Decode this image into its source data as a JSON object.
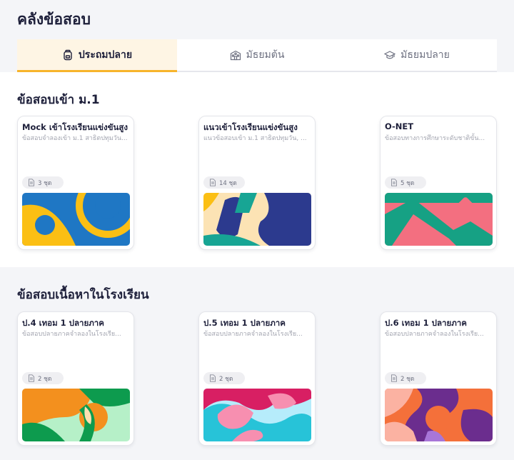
{
  "page_title": "คลังข้อสอบ",
  "tabs": [
    {
      "label": "ประถมปลาย",
      "icon": "backpack-icon",
      "active": true
    },
    {
      "label": "มัธยมต้น",
      "icon": "school-icon",
      "active": false
    },
    {
      "label": "มัธยมปลาย",
      "icon": "graduation-cap-icon",
      "active": false
    }
  ],
  "sections": [
    {
      "title": "ข้อสอบเข้า ม.1",
      "cards": [
        {
          "title": "Mock เข้าโรงเรียนแข่งขันสูง",
          "desc": "ข้อสอบจำลองเข้า ม.1 สาธิตปทุมวัน...",
          "badge": "3 ชุด"
        },
        {
          "title": "แนวเข้าโรงเรียนแข่งขันสูง",
          "desc": "แนวข้อสอบเข้า ม.1 สาธิตปทุมวัน, ...",
          "badge": "14 ชุด"
        },
        {
          "title": "O-NET",
          "desc": "ข้อสอบทางการศึกษาระดับชาติขั้น...",
          "badge": "5 ชุด"
        }
      ]
    },
    {
      "title": "ข้อสอบเนื้อหาในโรงเรียน",
      "cards": [
        {
          "title": "ป.4 เทอม 1 ปลายภาค",
          "desc": "ข้อสอบปลายภาคจำลองในโรงเรีย...",
          "badge": "2 ชุด"
        },
        {
          "title": "ป.5 เทอม 1 ปลายภาค",
          "desc": "ข้อสอบปลายภาคจำลองในโรงเรีย...",
          "badge": "2 ชุด"
        },
        {
          "title": "ป.6 เทอม 1 ปลายภาค",
          "desc": "ข้อสอบปลายภาคจำลองในโรงเรีย...",
          "badge": "2 ชุด"
        }
      ]
    }
  ],
  "colors": {
    "accent": "#f7b42c",
    "active_tab_bg": "#fef5e4",
    "title": "#1d1f3a"
  }
}
